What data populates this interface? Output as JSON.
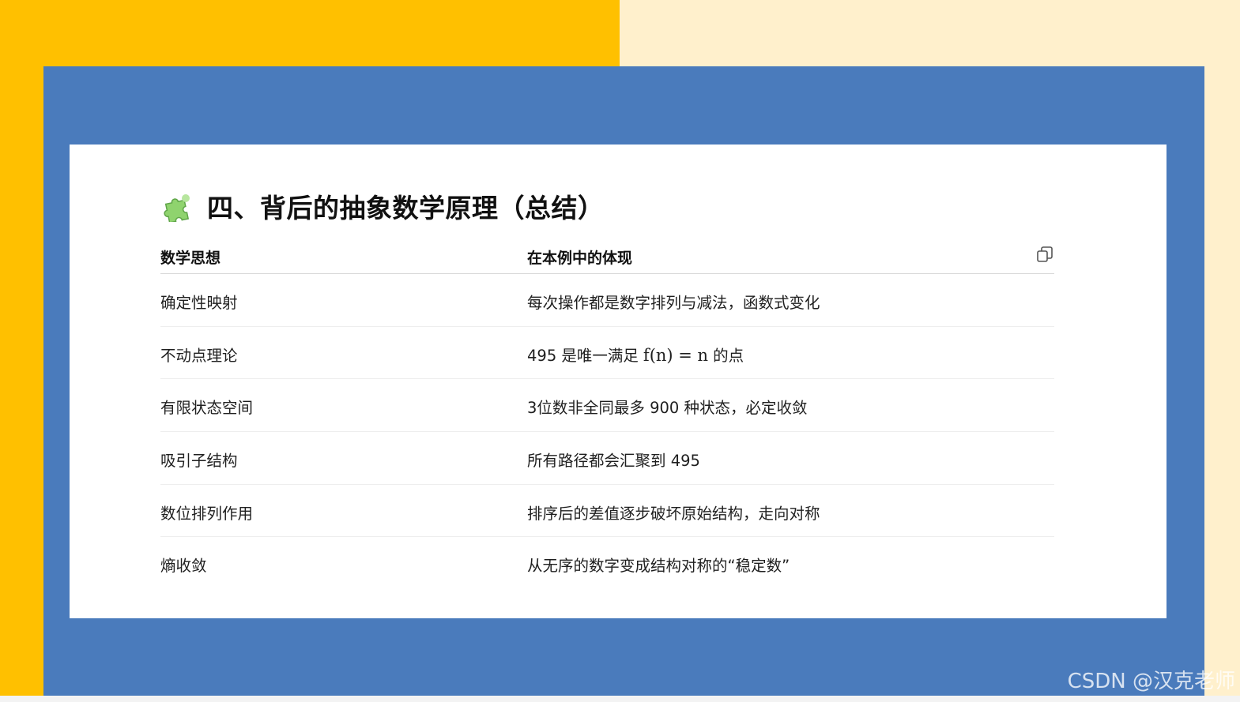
{
  "heading": {
    "icon": "puzzle-piece-icon",
    "title": "四、背后的抽象数学原理（总结）"
  },
  "table": {
    "columns": [
      "数学思想",
      "在本例中的体现"
    ],
    "copy_icon": "copy-icon",
    "rows": [
      {
        "concept": "确定性映射",
        "manifestation": "每次操作都是数字排列与减法，函数式变化"
      },
      {
        "concept": "不动点理论",
        "manifestation_prefix": "495 是唯一满足",
        "manifestation_math": "f(n) = n",
        "manifestation_suffix": "的点"
      },
      {
        "concept": "有限状态空间",
        "manifestation": "3位数非全同最多 900 种状态，必定收敛"
      },
      {
        "concept": "吸引子结构",
        "manifestation": "所有路径都会汇聚到 495"
      },
      {
        "concept": "数位排列作用",
        "manifestation": "排序后的差值逐步破坏原始结构，走向对称"
      },
      {
        "concept": "熵收敛",
        "manifestation": "从无序的数字变成结构对称的“稳定数”"
      }
    ]
  },
  "watermark": "CSDN @汉克老师",
  "colors": {
    "left_background": "#FFC000",
    "right_background": "#FFF0CC",
    "frame": "#4A7BBC",
    "card": "#FFFFFF"
  }
}
